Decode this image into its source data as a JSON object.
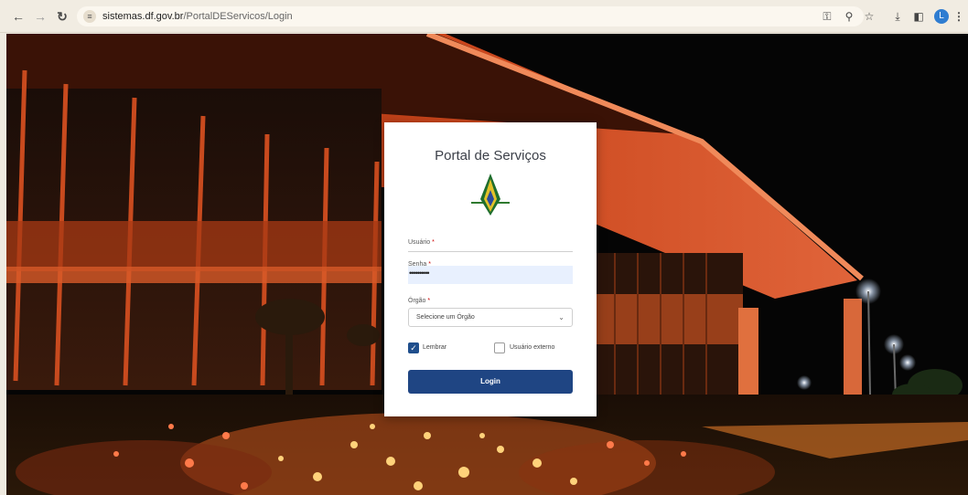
{
  "browser": {
    "url_domain": "sistemas.df.gov.br",
    "url_path": "/PortalDEServicos/Login",
    "profile_initial": "L"
  },
  "icons": {
    "back": "arrow-left-icon",
    "forward": "arrow-right-icon",
    "reload": "reload-icon",
    "site_info": "tune-icon",
    "password_key": "key-icon",
    "zoom": "zoom-icon",
    "bookmark": "star-icon",
    "download": "download-icon",
    "sidepanel": "sidepanel-icon",
    "menu": "more-vert-icon"
  },
  "card": {
    "title": "Portal de Serviços",
    "username_label": "Usuário",
    "username_value": "",
    "password_label": "Senha",
    "password_value": "••••••••••",
    "orgao_label": "Órgão",
    "orgao_selected": "Selecione um Órgão",
    "required_mark": "*",
    "remember_label": "Lembrar",
    "remember_checked": true,
    "external_label": "Usuário externo",
    "external_checked": false,
    "login_label": "Login"
  },
  "colors": {
    "primary": "#1f4583",
    "checkbox": "#1f4e8c",
    "password_autofill_bg": "#e8f0fe"
  }
}
